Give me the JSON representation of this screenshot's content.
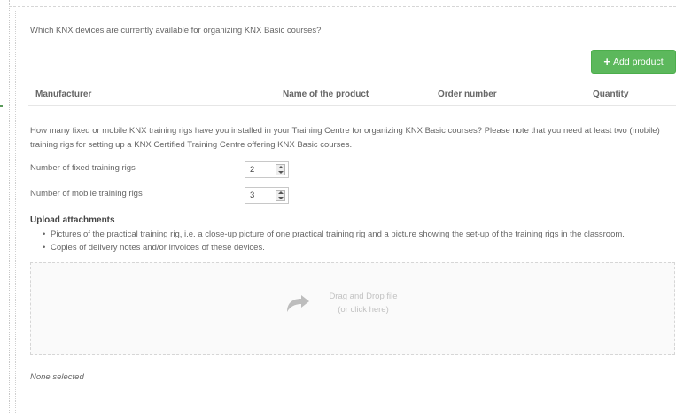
{
  "devices_question": "Which KNX devices are currently available for organizing KNX Basic courses?",
  "add_product_label": "Add product",
  "table_headers": {
    "manufacturer": "Manufacturer",
    "product_name": "Name of the product",
    "order_number": "Order number",
    "quantity": "Quantity"
  },
  "rigs_question": "How many fixed or mobile KNX training rigs have you installed in your Training Centre for organizing KNX Basic courses? Please note that you need at least two (mobile) training rigs for setting up a KNX Certified Training Centre offering KNX Basic courses.",
  "fixed_rigs": {
    "label": "Number of fixed training rigs",
    "value": "2"
  },
  "mobile_rigs": {
    "label": "Number of mobile training rigs",
    "value": "3"
  },
  "upload": {
    "title": "Upload attachments",
    "bullets": [
      "Pictures of the practical training rig, i.e. a close-up picture of one practical training rig and a picture showing the set-up of the training rigs in the classroom.",
      "Copies of delivery notes and/or invoices of these devices."
    ],
    "drop_line1": "Drag and Drop file",
    "drop_line2": "(or click here)",
    "none_selected": "None selected"
  },
  "colors": {
    "button_green": "#5cb85c",
    "text": "#666666",
    "dropzone_bg": "#fafafa"
  },
  "icons": {
    "add": "plus-icon",
    "upload": "upload-arrow-icon",
    "stepper": "stepper-arrows-icon"
  }
}
